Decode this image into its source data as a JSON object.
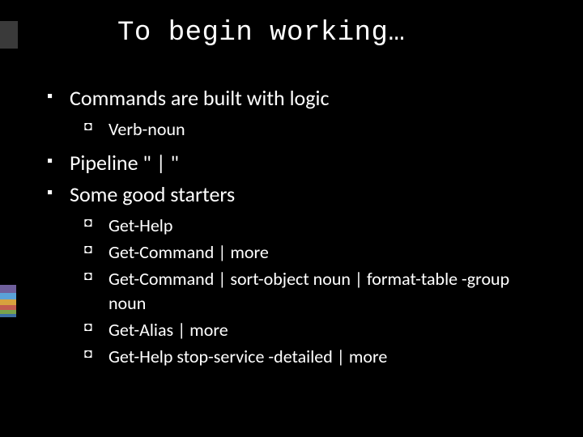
{
  "title": "To begin working…",
  "bullets": {
    "b1": "Commands are built with logic",
    "b1_sub": {
      "s1": "Verb-noun"
    },
    "b2": "Pipeline  \" | \"",
    "b3": "Some good starters",
    "b3_sub": {
      "s1": "Get-Help",
      "s2": "Get-Command | more",
      "s3": "Get-Command | sort-object noun | format-table -group noun",
      "s4": "Get-Alias | more",
      "s5": "Get-Help stop-service -detailed | more"
    }
  }
}
